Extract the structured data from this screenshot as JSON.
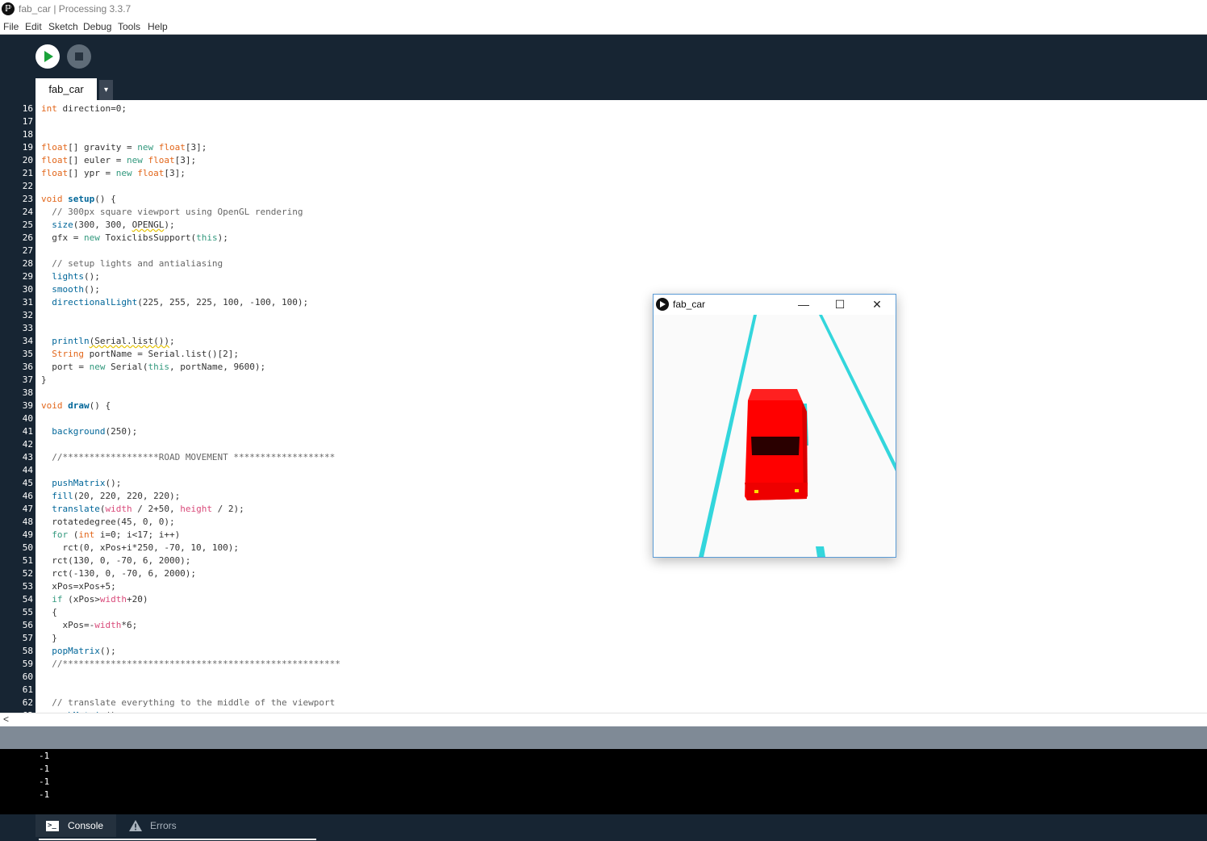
{
  "window": {
    "title": "fab_car | Processing 3.3.7",
    "app_icon_glyph": "ℙ"
  },
  "menu": [
    "File",
    "Edit",
    "Sketch",
    "Debug",
    "Tools",
    "Help"
  ],
  "toolbar": {
    "run_icon": "play-icon",
    "stop_icon": "stop-icon"
  },
  "tabs": {
    "active": "fab_car",
    "menu_arrow": "▾"
  },
  "editor": {
    "first_line": 16,
    "lines": [
      "int direction=0;",
      "",
      "",
      "float[] gravity = new float[3];",
      "float[] euler = new float[3];",
      "float[] ypr = new float[3];",
      "",
      "void setup() {",
      "  // 300px square viewport using OpenGL rendering",
      "  size(300, 300, OPENGL);",
      "  gfx = new ToxiclibsSupport(this);",
      "",
      "  // setup lights and antialiasing",
      "  lights();",
      "  smooth();",
      "  directionalLight(225, 255, 225, 100, -100, 100);",
      "",
      "",
      "  println(Serial.list());",
      "  String portName = Serial.list()[2];",
      "  port = new Serial(this, portName, 9600);",
      "}",
      "",
      "void draw() {",
      "",
      "  background(250);",
      "",
      "  //******************ROAD MOVEMENT *******************",
      "",
      "  pushMatrix();",
      "  fill(20, 220, 220, 220);",
      "  translate(width / 2+50, height / 2);",
      "  rotatedegree(45, 0, 0);",
      "  for (int i=0; i<17; i++)",
      "    rct(0, xPos+i*250, -70, 10, 100);",
      "  rct(130, 0, -70, 6, 2000);",
      "  rct(-130, 0, -70, 6, 2000);",
      "  xPos=xPos+5;",
      "  if (xPos>width+20)",
      "  {",
      "    xPos=-width*6;",
      "  }",
      "  popMatrix();",
      "  //****************************************************",
      "",
      "",
      "  // translate everything to the middle of the viewport",
      "  pushMatrix();"
    ]
  },
  "scroll": {
    "left_arrow": "<"
  },
  "console": {
    "lines": [
      "-1",
      "-1",
      "-1",
      "-1"
    ]
  },
  "footer_tabs": {
    "console_label": "Console",
    "console_icon_text": ">_",
    "errors_label": "Errors"
  },
  "sketch_window": {
    "title": "fab_car",
    "minimize": "—",
    "maximize": "☐",
    "close": "✕",
    "canvas_bg": "#fafafa",
    "road_color": "#33d6dc",
    "car_color": "#ff0000"
  },
  "colors": {
    "toolbar_bg": "#172533",
    "type": "#e2661a",
    "keyword": "#33997e",
    "function": "#006699",
    "builtin_var": "#d94a7a",
    "comment": "#666666"
  }
}
